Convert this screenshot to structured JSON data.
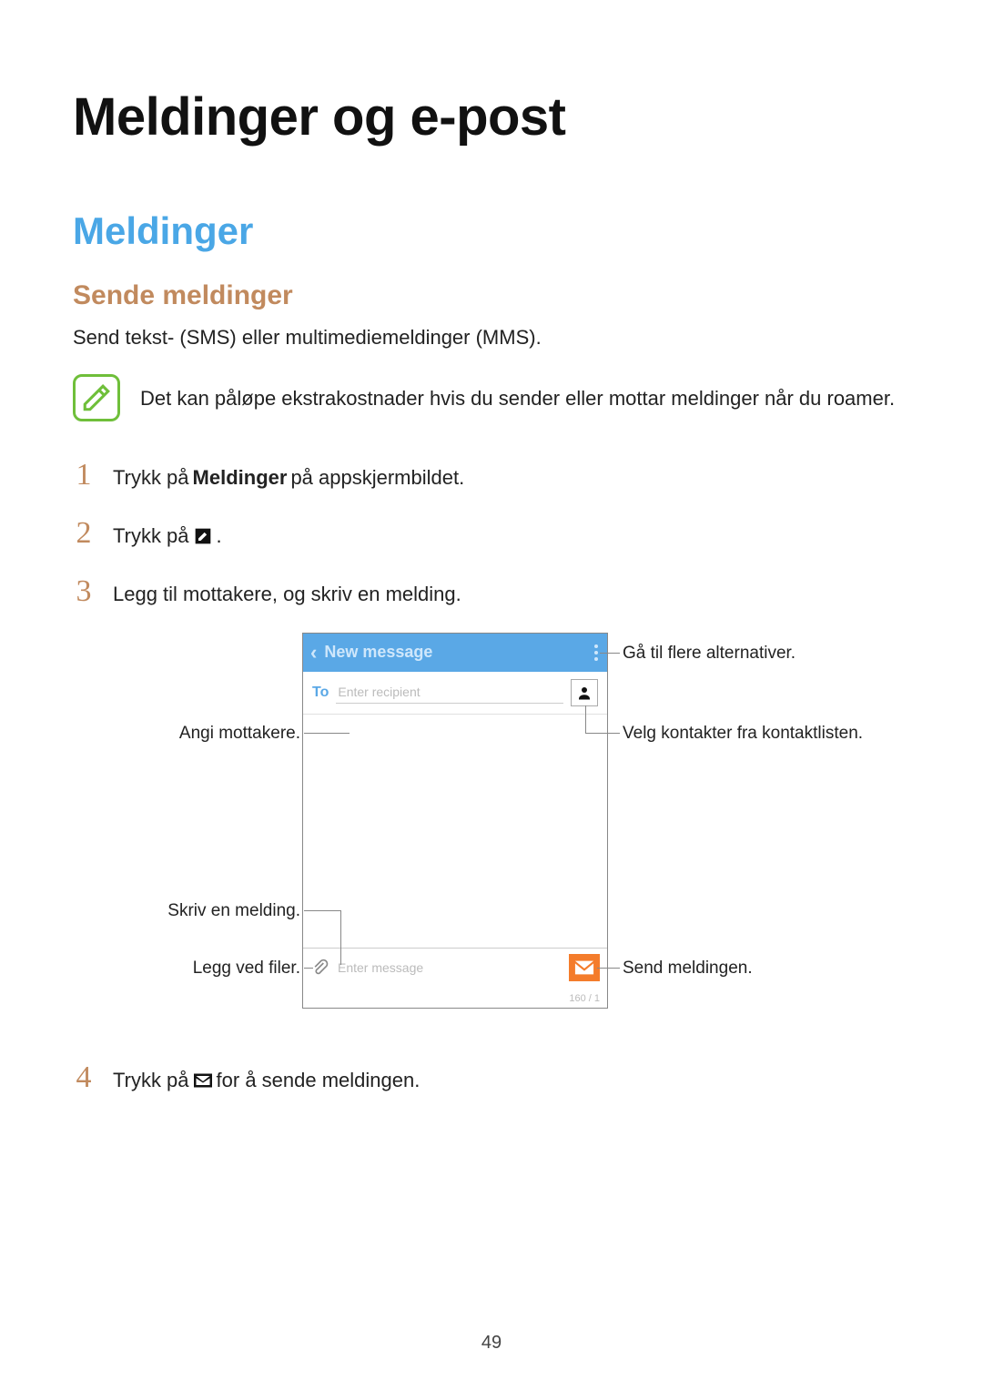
{
  "page": {
    "title": "Meldinger og e-post",
    "section": "Meldinger",
    "subsection": "Sende meldinger",
    "intro": "Send tekst- (SMS) eller multimediemeldinger (MMS).",
    "note": "Det kan påløpe ekstrakostnader hvis du sender eller mottar meldinger når du roamer.",
    "page_number": "49"
  },
  "steps": {
    "s1_pre": "Trykk på ",
    "s1_bold": "Meldinger",
    "s1_post": " på appskjermbildet.",
    "s2_pre": "Trykk på ",
    "s2_post": ".",
    "s3": "Legg til mottakere, og skriv en melding.",
    "s4_pre": "Trykk på ",
    "s4_post": " for å sende meldingen."
  },
  "phone": {
    "header_title": "New message",
    "to_label": "To",
    "recipient_placeholder": "Enter recipient",
    "compose_placeholder": "Enter message",
    "char_count": "160 / 1"
  },
  "callouts": {
    "more_options": "Gå til flere alternativer.",
    "recipients": "Angi mottakere.",
    "pick_contacts": "Velg kontakter fra kontaktlisten.",
    "write_message": "Skriv en melding.",
    "attach_files": "Legg ved filer.",
    "send_message": "Send meldingen."
  }
}
